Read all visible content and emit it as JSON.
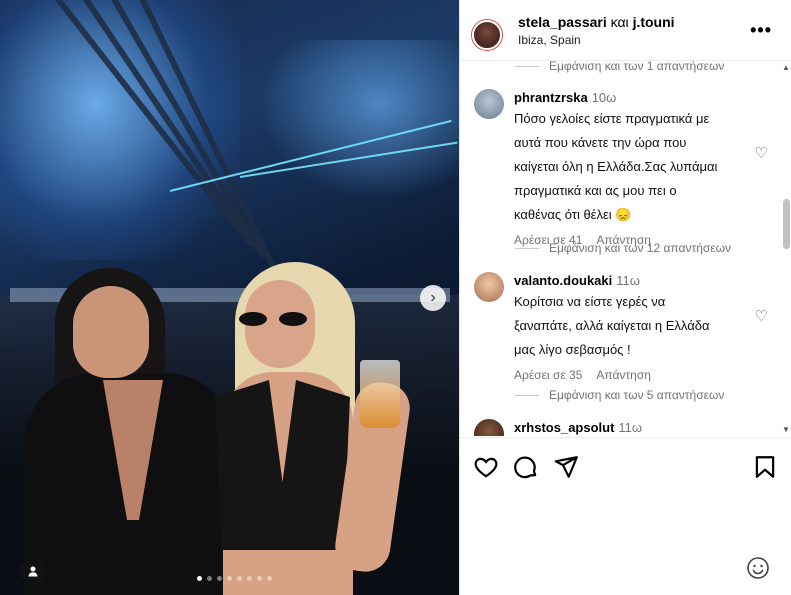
{
  "post": {
    "author": "stela_passari",
    "conjunction": "και",
    "coauthor": "j.touni",
    "location": "Ibiza, Spain",
    "more_icon": "more-horizontal-icon"
  },
  "carousel": {
    "slides": 8,
    "active_index": 0
  },
  "comments_section": {
    "view_replies_1": "Εμφάνιση και των 1 απαντήσεων",
    "comments": [
      {
        "username": "phrantzrska",
        "time": "10ω",
        "text": [
          "Πόσο γελοίες είστε πραγματικά με",
          "αυτά που κάνετε την ώρα που",
          "καίγεται όλη η Ελλάδα.Σας λυπάμαι",
          "πραγματικά και ας μου πει ο",
          "καθένας ότι θέλει 😞"
        ],
        "likes": "Αρέσει σε 41",
        "reply": "Απάντηση",
        "view_replies": "Εμφάνιση και των 12 απαντήσεων"
      },
      {
        "username": "valanto.doukaki",
        "time": "11ω",
        "text": [
          "Κορίτσια να είστε γερές να",
          "ξαναπάτε, αλλά καίγεται η Ελλάδα",
          "μας λίγο σεβασμός !"
        ],
        "likes": "Αρέσει σε 35",
        "reply": "Απάντηση",
        "view_replies": "Εμφάνιση και των 5 απαντήσεων"
      },
      {
        "username": "xrhstos_apsolut",
        "time": "11ω"
      }
    ]
  },
  "icons": {
    "like": "heart-icon",
    "comment": "comment-icon",
    "share": "send-icon",
    "save": "bookmark-icon",
    "emoji": "emoji-icon"
  },
  "colors": {
    "secondary_text": "#737373",
    "border": "#ececec"
  }
}
